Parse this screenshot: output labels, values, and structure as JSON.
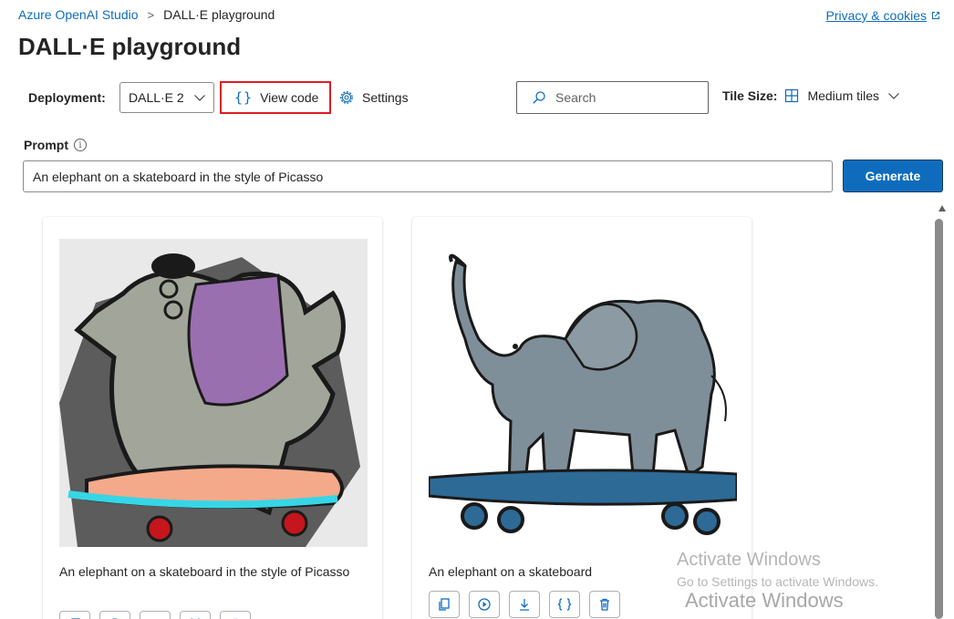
{
  "breadcrumb": {
    "root": "Azure OpenAI Studio",
    "separator": ">",
    "current": "DALL·E playground"
  },
  "privacy_link": "Privacy & cookies",
  "page_title": "DALL·E playground",
  "toolbar": {
    "deployment_label": "Deployment:",
    "deployment_value": "DALL·E 2",
    "view_code_label": "View code",
    "settings_label": "Settings",
    "search_placeholder": "Search",
    "tile_size_label": "Tile Size:",
    "tile_size_value": "Medium tiles"
  },
  "prompt": {
    "label": "Prompt",
    "info_icon": "i",
    "value": "An elephant on a skateboard in the style of Picasso"
  },
  "generate_label": "Generate",
  "results": [
    {
      "caption": "An elephant on a skateboard in the style of Picasso",
      "image": "picasso-style-elephant-skateboard"
    },
    {
      "caption": "An elephant on a skateboard",
      "image": "elephant-skateboard-illustration"
    }
  ],
  "card_actions": [
    "copy-icon",
    "view-icon",
    "download-icon",
    "code-icon",
    "delete-icon"
  ],
  "watermark": {
    "line1": "Activate Windows",
    "line2": "Go to Settings to activate Windows.",
    "line3": "Activate Windows"
  },
  "colors": {
    "accent": "#0f6cbd",
    "highlight_border": "#e01b24",
    "text": "#242424"
  }
}
